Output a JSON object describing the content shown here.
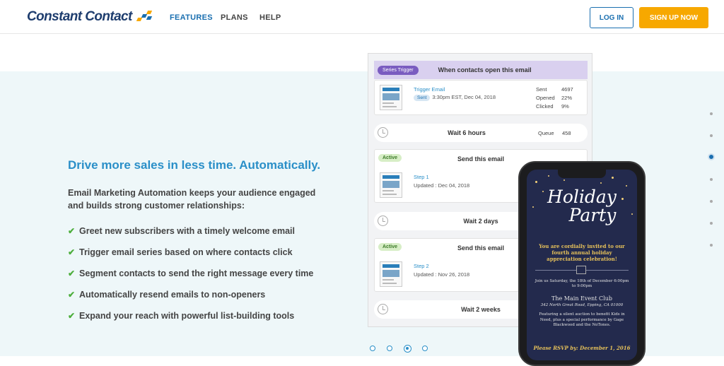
{
  "brand": {
    "logo_text": "Constant Contact",
    "accent": "#1a6fb0",
    "cta_color": "#f7a800"
  },
  "nav": {
    "links": [
      {
        "label": "FEATURES",
        "active": true
      },
      {
        "label": "PLANS",
        "active": false
      },
      {
        "label": "HELP",
        "active": false
      }
    ],
    "login_label": "LOG IN",
    "signup_label": "SIGN UP NOW"
  },
  "hero": {
    "headline": "Drive more sales in less time. Automatically.",
    "intro": "Email Marketing Automation keeps your audience engaged and builds strong customer relationships:",
    "features": [
      "Greet new subscribers with a timely welcome email",
      "Trigger email series based on where contacts click",
      "Segment contacts to send the right message every time",
      "Automatically resend emails to non-openers",
      "Expand your reach with powerful list-building tools"
    ]
  },
  "workflow": {
    "trigger_badge": "Series Trigger",
    "trigger_title": "When contacts open this email",
    "trigger_email": {
      "link": "Trigger Email",
      "sent_badge": "Sent",
      "sent_time": "3:30pm EST, Dec 04, 2018",
      "stats": [
        {
          "label": "Sent",
          "value": "4697"
        },
        {
          "label": "Opened",
          "value": "22%"
        },
        {
          "label": "Clicked",
          "value": "9%"
        }
      ]
    },
    "wait1": {
      "label": "Wait 6 hours",
      "queue_label": "Queue",
      "queue_value": "458"
    },
    "step1": {
      "badge": "Active",
      "title": "Send this email",
      "link": "Step 1",
      "updated": "Updated : Dec 04, 2018"
    },
    "wait2": {
      "label": "Wait 2 days"
    },
    "step2": {
      "badge": "Active",
      "title": "Send this email",
      "link": "Step 2",
      "updated": "Updated : Nov 26, 2018"
    },
    "wait3": {
      "label": "Wait 2 weeks"
    }
  },
  "phone": {
    "title_line1": "Holiday",
    "title_line2": "Party",
    "invite": "You are cordially invited to our fourth annual holiday appreciation celebration!",
    "join": "Join us Saturday, the 18th of December 6:00pm to 9:00pm",
    "venue": "The Main Event Club",
    "address": "342 North Great Road, Epping, CA 01000",
    "featuring": "Featuring a silent auction to benefit Kids in Need, plus a special performance by Gage Blackwood and the NoTones.",
    "rsvp": "Please RSVP by: December 1, 2016"
  },
  "section_dots": {
    "count": 7,
    "active_index": 2
  },
  "carousel_dots": {
    "count": 4,
    "active_index": 2
  }
}
